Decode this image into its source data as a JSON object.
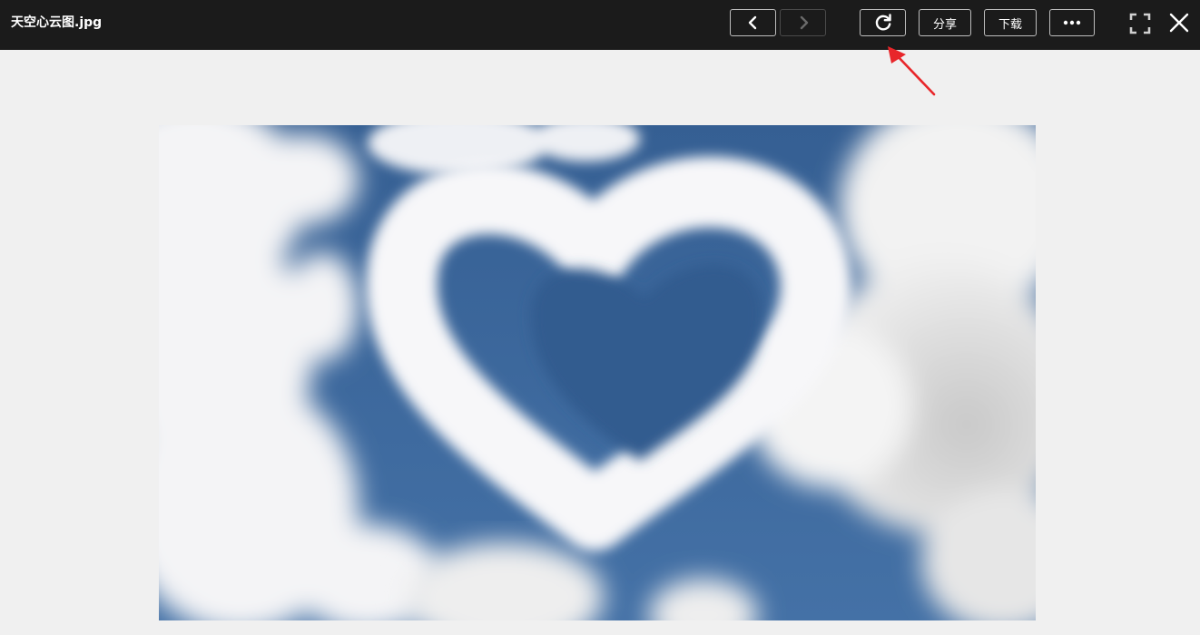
{
  "header": {
    "title": "天空心云图.jpg",
    "share_label": "分享",
    "download_label": "下载"
  },
  "icons": {
    "prev": "chevron-left-icon",
    "next": "chevron-right-icon",
    "rotate": "rotate-clockwise-icon",
    "more": "more-horizontal-icon",
    "fullscreen": "fullscreen-icon",
    "close": "close-icon",
    "annotation": "red-arrow-annotation"
  },
  "state": {
    "prev_enabled": true,
    "next_enabled": false
  },
  "colors": {
    "topbar": "#1b1b1b",
    "background": "#f0f0f0",
    "annotation_arrow": "#e8262a",
    "sky_blue": "#3a6597"
  }
}
